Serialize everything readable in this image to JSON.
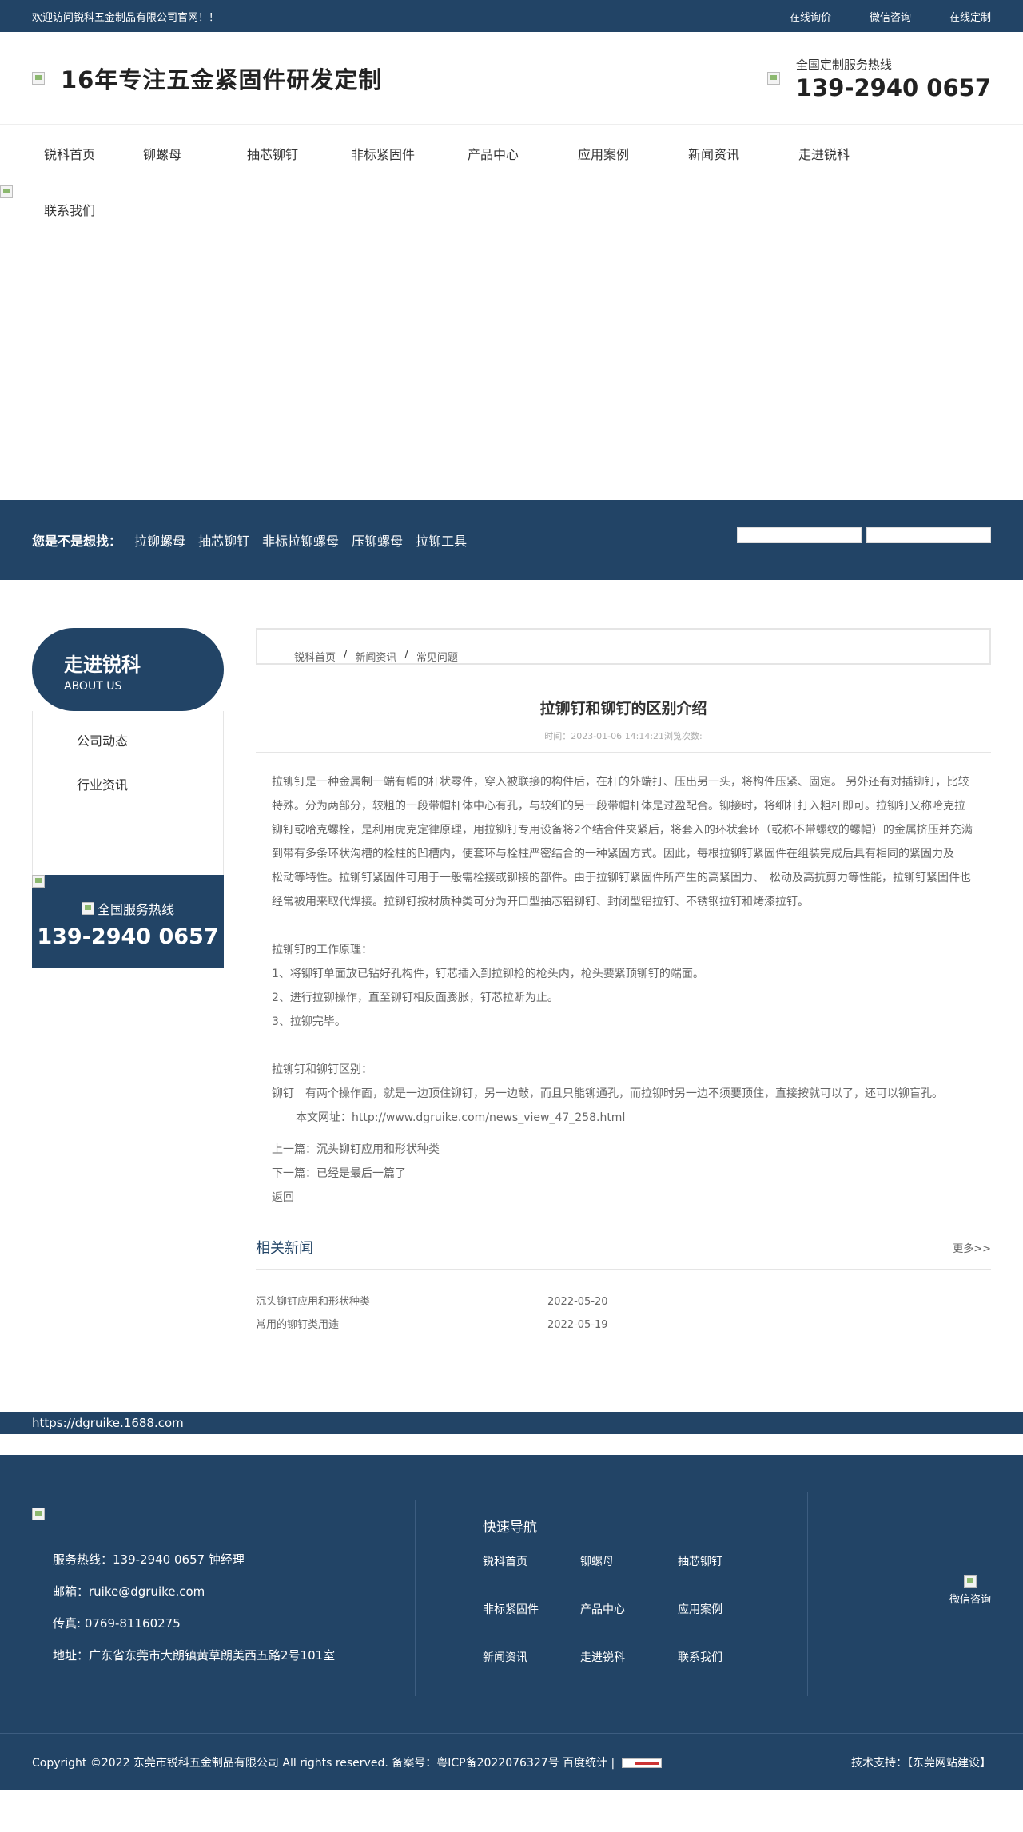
{
  "topbar": {
    "welcome": "欢迎访问锐科五金制品有限公司官网！！",
    "links": [
      "在线询价",
      "微信咨询",
      "在线定制"
    ]
  },
  "header": {
    "slogan": "16年专注五金紧固件研发定制",
    "hotline_label": "全国定制服务热线",
    "hotline_number": "139-2940 0657"
  },
  "nav": [
    "锐科首页",
    "铆螺母",
    "抽芯铆钉",
    "非标紧固件",
    "产品中心",
    "应用案例",
    "新闻资讯",
    "走进锐科"
  ],
  "banner": {
    "contact": "联系我们"
  },
  "strip": {
    "lead": "您是不是想找：",
    "keywords": [
      "拉铆螺母",
      "抽芯铆钉",
      "非标拉铆螺母",
      "压铆螺母",
      "拉铆工具"
    ]
  },
  "sidebar": {
    "title": "走进锐科",
    "subtitle": "ABOUT US",
    "items": [
      "公司动态",
      "行业资讯"
    ],
    "hotline_label": "全国服务热线",
    "hotline_number": "139-2940 0657"
  },
  "breadcrumb": [
    "锐科首页",
    "新闻资讯",
    "常见问题"
  ],
  "article": {
    "title": "拉铆钉和铆钉的区别介绍",
    "meta": "时间：2023-01-06 14:14:21浏览次数:",
    "para1": "拉铆钉是一种金属制一端有帽的杆状零件，穿入被联接的构件后，在杆的外端打、压出另一头，将构件压紧、固定。 另外还有对插铆钉，比较特殊。分为两部分，较粗的一段带帽杆体中心有孔，与较细的另一段带帽杆体是过盈配合。铆接时，将细杆打入粗杆即可。拉铆钉又称哈克拉铆钉或哈克螺栓，是利用虎克定律原理，用拉铆钉专用设备将2个结合件夹紧后，将套入的环状套环（或称不带螺纹的螺帽）的金属挤压并充满到带有多条环状沟槽的栓柱的凹槽内，使套环与栓柱严密结合的一种紧固方式。因此，每根拉铆钉紧固件在组装完成后具有相同的紧固力及　松动等特性。拉铆钉紧固件可用于一般需栓接或铆接的部件。由于拉铆钉紧固件所产生的高紧固力、　松动及高抗剪力等性能，拉铆钉紧固件也经常被用来取代焊接。拉铆钉按材质种类可分为开口型抽芯铝铆钉、封闭型铝拉钉、不锈钢拉钉和烤漆拉钉。",
    "principle_title": "拉铆钉的工作原理：",
    "principle_steps": [
      "1、将铆钉单面放已钻好孔构件，钉芯插入到拉铆枪的枪头内，枪头要紧顶铆钉的端面。",
      "2、进行拉铆操作，直至铆钉相反面膨胀，钉芯拉断为止。",
      "3、拉铆完毕。"
    ],
    "diff_title": "拉铆钉和铆钉区别：",
    "diff_text": "铆钉　有两个操作面，就是一边顶住铆钉，另一边敲，而且只能铆通孔，而拉铆时另一边不须要顶住，直接按就可以了，还可以铆盲孔。",
    "url_line": "本文网址：http://www.dgruike.com/news_view_47_258.html",
    "prev": "上一篇：沉头铆钉应用和形状种类",
    "next": "下一篇：已经是最后一篇了",
    "back": "返回"
  },
  "related": {
    "title": "相关新闻",
    "more": "更多>>",
    "items": [
      {
        "name": "沉头铆钉应用和形状种类",
        "date": "2022-05-20"
      },
      {
        "name": "常用的铆钉类用途",
        "date": "2022-05-19"
      }
    ]
  },
  "urlbar": "https://dgruike.1688.com",
  "footer": {
    "phone": "服务热线：139-2940 0657 钟经理",
    "email": "邮箱：ruike@dgruike.com",
    "fax": "传真: 0769-81160275",
    "address": "地址：广东省东莞市大朗镇黄草朗美西五路2号101室",
    "quick_nav_title": "快速导航",
    "quick_nav": [
      "锐科首页",
      "铆螺母",
      "抽芯铆钉",
      "非标紧固件",
      "产品中心",
      "应用案例",
      "新闻资讯",
      "走进锐科",
      "联系我们"
    ],
    "wechat": "微信咨询",
    "copyright": "Copyright ©2022 东莞市锐科五金制品有限公司  All rights reserved. 备案号：粤ICP备2022076327号 百度统计 |",
    "tech": "技术支持：【东莞网站建设】"
  }
}
